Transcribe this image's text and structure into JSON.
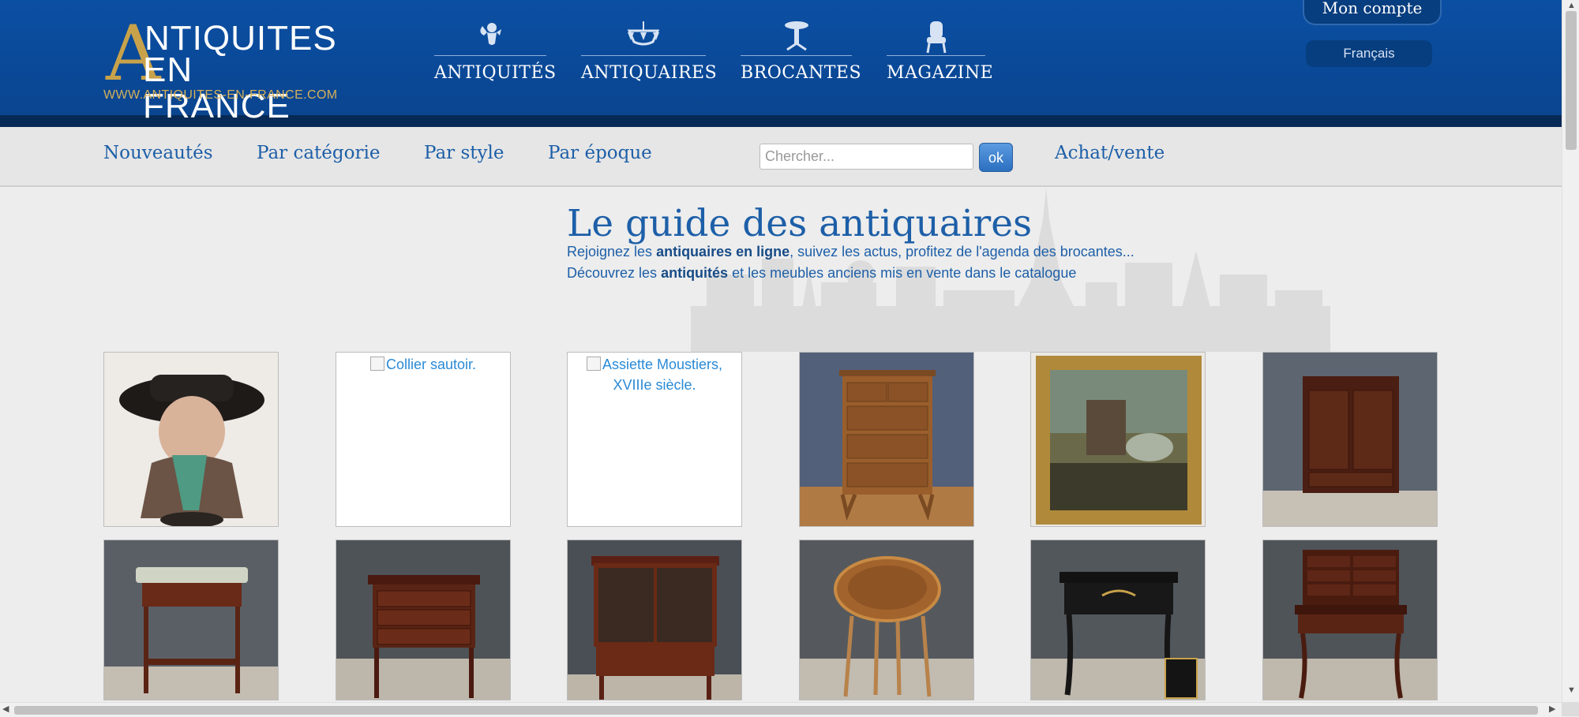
{
  "logo": {
    "big_letter": "A",
    "line1": "NTIQUITES",
    "line2": "EN FRANCE",
    "url": "WWW.ANTIQUITES-EN-FRANCE.COM"
  },
  "main_nav": [
    {
      "label": "ANTIQUITÉS",
      "icon": "cherub-icon"
    },
    {
      "label": "ANTIQUAIRES",
      "icon": "chandelier-icon"
    },
    {
      "label": "BROCANTES",
      "icon": "pedestal-table-icon"
    },
    {
      "label": "MAGAZINE",
      "icon": "armchair-icon"
    }
  ],
  "account": {
    "label": "Mon compte"
  },
  "language": {
    "label": "Français"
  },
  "sub_nav": {
    "items": [
      "Nouveautés",
      "Par catégorie",
      "Par style",
      "Par époque"
    ],
    "search_placeholder": "Chercher...",
    "search_button": "ok",
    "buy_sell": "Achat/vente"
  },
  "guide": {
    "title": "Le guide des antiquaires",
    "p1_before": "Rejoignez les ",
    "p1_bold": "antiquaires en ligne",
    "p1_after": ", suivez les actus, profitez de l'agenda des brocantes...",
    "p2_before": "Découvrez les ",
    "p2_bold": "antiquités",
    "p2_after": " et les meubles anciens mis en vente dans le catalogue"
  },
  "thumbnails": [
    {
      "kind": "ceramic-figure-jug-image"
    },
    {
      "kind": "broken-image",
      "alt": "Collier sautoir."
    },
    {
      "kind": "broken-image",
      "alt": "Assiette Moustiers, XVIIIe siècle."
    },
    {
      "kind": "walnut-chest-of-drawers-image"
    },
    {
      "kind": "framed-landscape-painting-image"
    },
    {
      "kind": "mahogany-cabinet-image"
    },
    {
      "kind": "marble-top-side-table-image"
    },
    {
      "kind": "mahogany-drawer-table-image"
    },
    {
      "kind": "glazed-bookcase-image"
    },
    {
      "kind": "round-marquetry-table-image"
    },
    {
      "kind": "black-napoleon-iii-desk-image"
    },
    {
      "kind": "ladies-writing-desk-image"
    }
  ],
  "colors": {
    "header_blue": "#0a4a99",
    "link_blue": "#1d5fa8",
    "gold": "#c8a24a",
    "page_bg": "#ededed"
  }
}
